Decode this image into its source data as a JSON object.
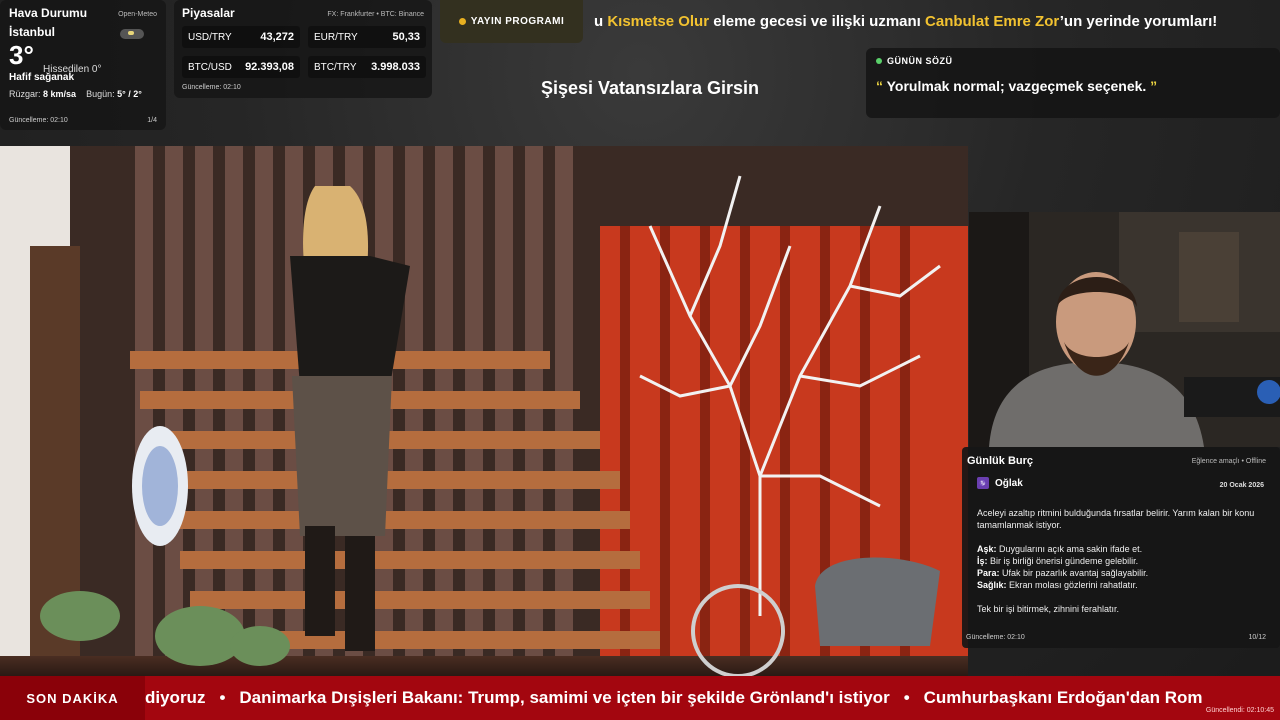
{
  "weather": {
    "title": "Hava Durumu",
    "source": "Open-Meteo",
    "city": "İstanbul",
    "temperature": "3°",
    "feels_like": "Hissedilen 0°",
    "condition": "Hafif sağanak",
    "wind_label": "Rüzgar:",
    "wind_value": "8 km/sa",
    "today_label": "Bugün:",
    "today_value": "5° / 2°",
    "updated": "Güncelleme: 02:10",
    "page": "1/4",
    "icon": "cloud-rain-icon"
  },
  "markets": {
    "title": "Piyasalar",
    "source": "FX: Frankfurter • BTC: Binance",
    "items": [
      {
        "label": "USD/TRY",
        "value": "43,272"
      },
      {
        "label": "EUR/TRY",
        "value": "50,33"
      },
      {
        "label": "BTC/USD",
        "value": "92.393,08"
      },
      {
        "label": "BTC/TRY",
        "value": "3.998.033"
      }
    ],
    "updated": "Güncelleme: 02:10"
  },
  "schedule": {
    "label": "YAYIN PROGRAMI",
    "ticker_pre": "u ",
    "ticker_hl1": "Kısmetse Olur",
    "ticker_mid": " eleme gecesi ve ilişki uzmanı ",
    "ticker_hl2": "Canbulat Emre Zor",
    "ticker_post": "’un yerinde yorumları!"
  },
  "show_title": "Şişesi Vatansızlara Girsin",
  "quote": {
    "label": "GÜNÜN SÖZÜ",
    "open": "“",
    "text": " Yorulmak normal; vazgeçmek seçenek. ",
    "close": "”"
  },
  "horoscope": {
    "title": "Günlük Burç",
    "tag": "Eğlence amaçlı • Offline",
    "badge": "♑",
    "sign": "Oğlak",
    "date": "20 Ocak 2026",
    "intro": "Aceleyi azaltıp ritmini bulduğunda fırsatlar belirir. Yarım kalan bir konu tamamlanmak istiyor.",
    "love_label": "Aşk:",
    "love": " Duygularını açık ama sakin ifade et.",
    "work_label": "İş:",
    "work": " Bir iş birliği önerisi gündeme gelebilir.",
    "money_label": "Para:",
    "money": " Ufak bir pazarlık avantaj sağlayabilir.",
    "health_label": "Sağlık:",
    "health": " Ekran molası gözlerini rahatlatır.",
    "closing": "Tek bir işi bitirmek, zihnini ferahlatır.",
    "updated": "Güncelleme: 02:10",
    "page": "10/12"
  },
  "news": {
    "label": "SON DAKİKA",
    "item0": "diyoruz",
    "item1": "Danimarka Dışişleri Bakanı: Trump, samimi ve içten bir şekilde Grönland'ı istiyor",
    "item2": "Cumhurbaşkanı Erdoğan'dan Rom",
    "separator": "•",
    "updated": "Güncellendi: 02:10:45"
  },
  "colors": {
    "accent_yellow": "#f2c230",
    "news_red": "#a3060f",
    "live_green": "#5ad06a"
  }
}
